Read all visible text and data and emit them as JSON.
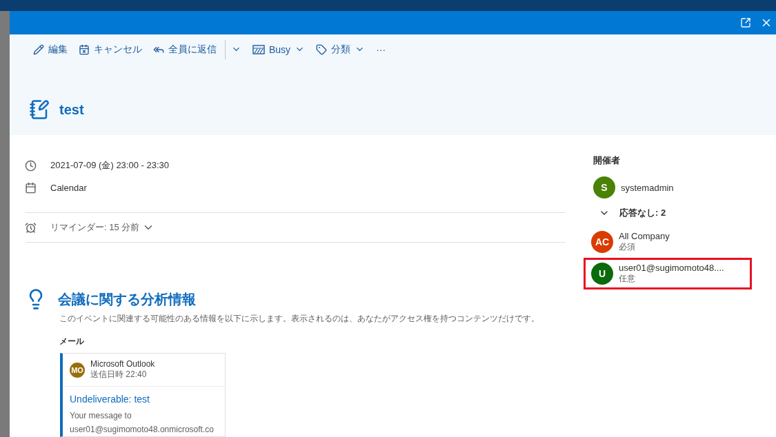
{
  "window": {
    "actions": [
      {
        "kind": "popout"
      },
      {
        "kind": "close"
      }
    ]
  },
  "toolbar": [
    {
      "kind": "edit",
      "label": "編集"
    },
    {
      "kind": "cancel",
      "label": "キャンセル"
    },
    {
      "kind": "reply-all",
      "label": "全員に返信"
    },
    {
      "kind": "busy",
      "label": "Busy"
    },
    {
      "kind": "category",
      "label": "分類"
    },
    {
      "kind": "more",
      "label": "···"
    }
  ],
  "event": {
    "title": "test",
    "details": [
      {
        "kind": "time",
        "text": "2021-07-09 (金) 23:00 - 23:30"
      },
      {
        "kind": "calendar",
        "text": "Calendar"
      }
    ],
    "reminder": "リマインダー: 15 分前"
  },
  "insights": {
    "title": "会議に関する分析情報",
    "description": "このイベントに関連する可能性のある情報を以下に示します。表示されるのは、あなたがアクセス権を持つコンテンツだけです。",
    "section": "メール",
    "mail": {
      "initials": "MO",
      "color": "#986f0b",
      "sender": "Microsoft Outlook",
      "sent": "送信日時 22:40",
      "subject": "Undeliverable: test",
      "preview": [
        "Your message to",
        "user01@sugimomoto48.onmicrosoft.co"
      ]
    }
  },
  "attendees": {
    "organizer_label": "開催者",
    "organizer": {
      "initials": "S",
      "name": "systemadmin",
      "color": "#498205"
    },
    "group": {
      "label": "応答なし: 2",
      "expanded": true
    },
    "people": [
      {
        "initials": "AC",
        "name": "All Company",
        "role": "必須",
        "color": "#da3b01",
        "highlighted": false
      },
      {
        "initials": "U",
        "name": "user01@sugimomoto48....",
        "role": "任意",
        "color": "#0b6a0b",
        "highlighted": true
      }
    ]
  }
}
